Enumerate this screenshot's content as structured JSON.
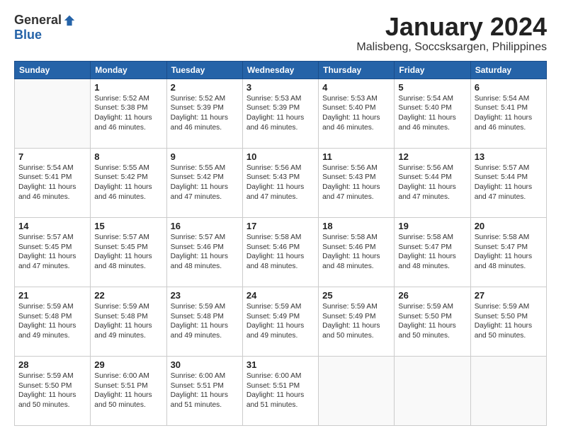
{
  "logo": {
    "general": "General",
    "blue": "Blue"
  },
  "title": "January 2024",
  "subtitle": "Malisbeng, Soccsksargen, Philippines",
  "days_of_week": [
    "Sunday",
    "Monday",
    "Tuesday",
    "Wednesday",
    "Thursday",
    "Friday",
    "Saturday"
  ],
  "weeks": [
    [
      {
        "day": "",
        "info": ""
      },
      {
        "day": "1",
        "info": "Sunrise: 5:52 AM\nSunset: 5:38 PM\nDaylight: 11 hours\nand 46 minutes."
      },
      {
        "day": "2",
        "info": "Sunrise: 5:52 AM\nSunset: 5:39 PM\nDaylight: 11 hours\nand 46 minutes."
      },
      {
        "day": "3",
        "info": "Sunrise: 5:53 AM\nSunset: 5:39 PM\nDaylight: 11 hours\nand 46 minutes."
      },
      {
        "day": "4",
        "info": "Sunrise: 5:53 AM\nSunset: 5:40 PM\nDaylight: 11 hours\nand 46 minutes."
      },
      {
        "day": "5",
        "info": "Sunrise: 5:54 AM\nSunset: 5:40 PM\nDaylight: 11 hours\nand 46 minutes."
      },
      {
        "day": "6",
        "info": "Sunrise: 5:54 AM\nSunset: 5:41 PM\nDaylight: 11 hours\nand 46 minutes."
      }
    ],
    [
      {
        "day": "7",
        "info": "Sunrise: 5:54 AM\nSunset: 5:41 PM\nDaylight: 11 hours\nand 46 minutes."
      },
      {
        "day": "8",
        "info": "Sunrise: 5:55 AM\nSunset: 5:42 PM\nDaylight: 11 hours\nand 46 minutes."
      },
      {
        "day": "9",
        "info": "Sunrise: 5:55 AM\nSunset: 5:42 PM\nDaylight: 11 hours\nand 47 minutes."
      },
      {
        "day": "10",
        "info": "Sunrise: 5:56 AM\nSunset: 5:43 PM\nDaylight: 11 hours\nand 47 minutes."
      },
      {
        "day": "11",
        "info": "Sunrise: 5:56 AM\nSunset: 5:43 PM\nDaylight: 11 hours\nand 47 minutes."
      },
      {
        "day": "12",
        "info": "Sunrise: 5:56 AM\nSunset: 5:44 PM\nDaylight: 11 hours\nand 47 minutes."
      },
      {
        "day": "13",
        "info": "Sunrise: 5:57 AM\nSunset: 5:44 PM\nDaylight: 11 hours\nand 47 minutes."
      }
    ],
    [
      {
        "day": "14",
        "info": "Sunrise: 5:57 AM\nSunset: 5:45 PM\nDaylight: 11 hours\nand 47 minutes."
      },
      {
        "day": "15",
        "info": "Sunrise: 5:57 AM\nSunset: 5:45 PM\nDaylight: 11 hours\nand 48 minutes."
      },
      {
        "day": "16",
        "info": "Sunrise: 5:57 AM\nSunset: 5:46 PM\nDaylight: 11 hours\nand 48 minutes."
      },
      {
        "day": "17",
        "info": "Sunrise: 5:58 AM\nSunset: 5:46 PM\nDaylight: 11 hours\nand 48 minutes."
      },
      {
        "day": "18",
        "info": "Sunrise: 5:58 AM\nSunset: 5:46 PM\nDaylight: 11 hours\nand 48 minutes."
      },
      {
        "day": "19",
        "info": "Sunrise: 5:58 AM\nSunset: 5:47 PM\nDaylight: 11 hours\nand 48 minutes."
      },
      {
        "day": "20",
        "info": "Sunrise: 5:58 AM\nSunset: 5:47 PM\nDaylight: 11 hours\nand 48 minutes."
      }
    ],
    [
      {
        "day": "21",
        "info": "Sunrise: 5:59 AM\nSunset: 5:48 PM\nDaylight: 11 hours\nand 49 minutes."
      },
      {
        "day": "22",
        "info": "Sunrise: 5:59 AM\nSunset: 5:48 PM\nDaylight: 11 hours\nand 49 minutes."
      },
      {
        "day": "23",
        "info": "Sunrise: 5:59 AM\nSunset: 5:48 PM\nDaylight: 11 hours\nand 49 minutes."
      },
      {
        "day": "24",
        "info": "Sunrise: 5:59 AM\nSunset: 5:49 PM\nDaylight: 11 hours\nand 49 minutes."
      },
      {
        "day": "25",
        "info": "Sunrise: 5:59 AM\nSunset: 5:49 PM\nDaylight: 11 hours\nand 50 minutes."
      },
      {
        "day": "26",
        "info": "Sunrise: 5:59 AM\nSunset: 5:50 PM\nDaylight: 11 hours\nand 50 minutes."
      },
      {
        "day": "27",
        "info": "Sunrise: 5:59 AM\nSunset: 5:50 PM\nDaylight: 11 hours\nand 50 minutes."
      }
    ],
    [
      {
        "day": "28",
        "info": "Sunrise: 5:59 AM\nSunset: 5:50 PM\nDaylight: 11 hours\nand 50 minutes."
      },
      {
        "day": "29",
        "info": "Sunrise: 6:00 AM\nSunset: 5:51 PM\nDaylight: 11 hours\nand 50 minutes."
      },
      {
        "day": "30",
        "info": "Sunrise: 6:00 AM\nSunset: 5:51 PM\nDaylight: 11 hours\nand 51 minutes."
      },
      {
        "day": "31",
        "info": "Sunrise: 6:00 AM\nSunset: 5:51 PM\nDaylight: 11 hours\nand 51 minutes."
      },
      {
        "day": "",
        "info": ""
      },
      {
        "day": "",
        "info": ""
      },
      {
        "day": "",
        "info": ""
      }
    ]
  ]
}
